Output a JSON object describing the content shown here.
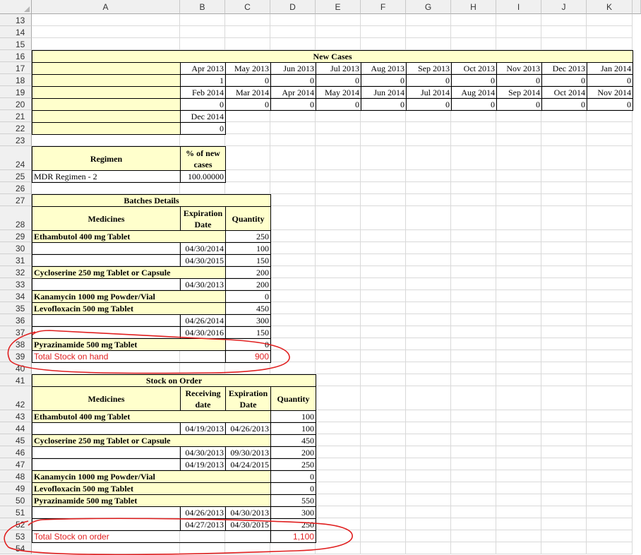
{
  "columns": [
    "A",
    "B",
    "C",
    "D",
    "E",
    "F",
    "G",
    "H",
    "I",
    "J",
    "K"
  ],
  "rows": [
    "13",
    "14",
    "15",
    "16",
    "17",
    "18",
    "19",
    "20",
    "21",
    "22",
    "23",
    "24",
    "25",
    "26",
    "27",
    "28",
    "29",
    "30",
    "31",
    "32",
    "33",
    "34",
    "35",
    "36",
    "37",
    "38",
    "39",
    "40",
    "41",
    "42",
    "43",
    "44",
    "45",
    "46",
    "47",
    "48",
    "49",
    "50",
    "51",
    "52",
    "53",
    "54"
  ],
  "new_cases": {
    "title": "New Cases",
    "months_row1": [
      "Apr 2013",
      "May 2013",
      "Jun 2013",
      "Jul 2013",
      "Aug 2013",
      "Sep 2013",
      "Oct 2013",
      "Nov 2013",
      "Dec 2013",
      "Jan 2014"
    ],
    "values_row1": [
      "1",
      "0",
      "0",
      "0",
      "0",
      "0",
      "0",
      "0",
      "0",
      "0"
    ],
    "months_row2": [
      "Feb 2014",
      "Mar 2014",
      "Apr 2014",
      "May 2014",
      "Jun 2014",
      "Jul 2014",
      "Aug 2014",
      "Sep 2014",
      "Oct 2014",
      "Nov 2014"
    ],
    "values_row2": [
      "0",
      "0",
      "0",
      "0",
      "0",
      "0",
      "0",
      "0",
      "0",
      "0"
    ],
    "months_row3": [
      "Dec 2014"
    ],
    "values_row3": [
      "0"
    ]
  },
  "regimen": {
    "header": "Regimen",
    "pct_header": "% of new cases",
    "name": "MDR Regimen - 2",
    "pct": "100.00000"
  },
  "batches": {
    "title": "Batches Details",
    "col_medicines": "Medicines",
    "col_expiration": "Expiration Date",
    "col_quantity": "Quantity",
    "rows": [
      {
        "medicine": "Ethambutol  400 mg  Tablet",
        "date": "",
        "qty": "250"
      },
      {
        "medicine": "",
        "date": "04/30/2014",
        "qty": "100"
      },
      {
        "medicine": "",
        "date": "04/30/2015",
        "qty": "150"
      },
      {
        "medicine": "Cycloserine  250 mg  Tablet or Capsule",
        "date": "",
        "qty": "200"
      },
      {
        "medicine": "",
        "date": "04/30/2013",
        "qty": "200"
      },
      {
        "medicine": "Kanamycin  1000 mg  Powder/Vial",
        "date": "",
        "qty": "0"
      },
      {
        "medicine": "Levofloxacin  500 mg  Tablet",
        "date": "",
        "qty": "450"
      },
      {
        "medicine": "",
        "date": "04/26/2014",
        "qty": "300"
      },
      {
        "medicine": "",
        "date": "04/30/2016",
        "qty": "150"
      },
      {
        "medicine": "Pyrazinamide  500 mg  Tablet",
        "date": "",
        "qty": "0"
      }
    ],
    "total_label": "Total Stock on hand",
    "total_value": "900"
  },
  "orders": {
    "title": "Stock on Order",
    "col_medicines": "Medicines",
    "col_receiving": "Receiving date",
    "col_expiration": "Expiration Date",
    "col_quantity": "Quantity",
    "rows": [
      {
        "medicine": "Ethambutol  400 mg  Tablet",
        "recv": "",
        "exp": "",
        "qty": "100"
      },
      {
        "medicine": "",
        "recv": "04/19/2013",
        "exp": "04/26/2013",
        "qty": "100"
      },
      {
        "medicine": "Cycloserine  250 mg  Tablet or Capsule",
        "recv": "",
        "exp": "",
        "qty": "450"
      },
      {
        "medicine": "",
        "recv": "04/30/2013",
        "exp": "09/30/2013",
        "qty": "200"
      },
      {
        "medicine": "",
        "recv": "04/19/2013",
        "exp": "04/24/2015",
        "qty": "250"
      },
      {
        "medicine": "Kanamycin  1000 mg  Powder/Vial",
        "recv": "",
        "exp": "",
        "qty": "0"
      },
      {
        "medicine": "Levofloxacin  500 mg  Tablet",
        "recv": "",
        "exp": "",
        "qty": "0"
      },
      {
        "medicine": "Pyrazinamide  500 mg  Tablet",
        "recv": "",
        "exp": "",
        "qty": "550"
      },
      {
        "medicine": "",
        "recv": "04/26/2013",
        "exp": "04/30/2013",
        "qty": "300"
      },
      {
        "medicine": "",
        "recv": "04/27/2013",
        "exp": "04/30/2015",
        "qty": "250"
      }
    ],
    "total_label": "Total Stock on order",
    "total_value": "1,100"
  },
  "colors": {
    "cell_fill": "#ffffcc",
    "header_bg": "#f0f0f0",
    "annotation": "#e02020"
  }
}
